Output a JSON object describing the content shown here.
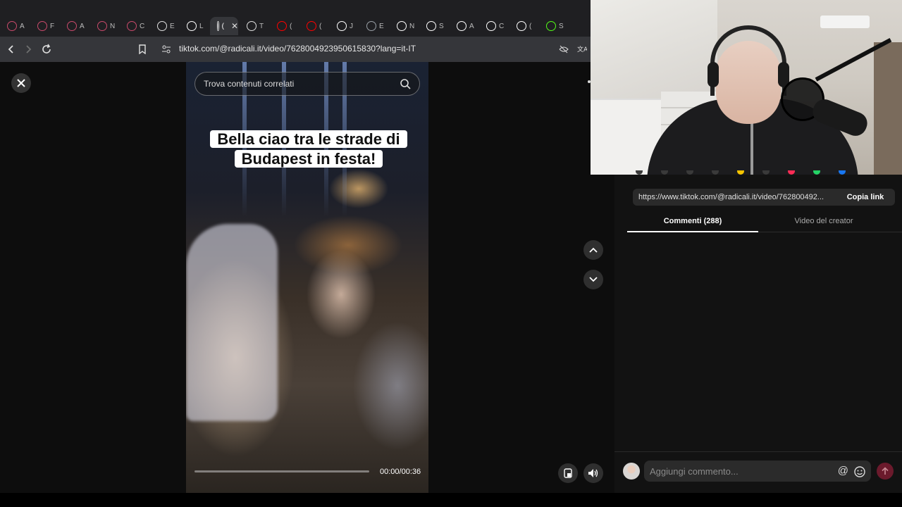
{
  "browser": {
    "tabs": [
      {
        "letter": "A",
        "icon": "record-icon",
        "color": "#c94a6b"
      },
      {
        "letter": "F",
        "icon": "record-icon",
        "color": "#c94a6b"
      },
      {
        "letter": "A",
        "icon": "record-icon",
        "color": "#c94a6b"
      },
      {
        "letter": "N",
        "icon": "record-icon",
        "color": "#c94a6b"
      },
      {
        "letter": "C",
        "icon": "puzzle-icon",
        "color": "#c94a6b"
      },
      {
        "letter": "E",
        "icon": "wordpress-icon",
        "color": "#e0e0e0"
      },
      {
        "letter": "L",
        "icon": "wikipedia-icon",
        "color": "#ffffff"
      },
      {
        "letter": "(",
        "icon": "tiktok-icon",
        "color": "#ffffff",
        "active": true
      },
      {
        "letter": "T",
        "icon": "play-icon",
        "color": "#e0e0e0"
      },
      {
        "letter": "(",
        "icon": "youtube-icon",
        "color": "#ff0000"
      },
      {
        "letter": "(",
        "icon": "youtube-icon",
        "color": "#ff0000"
      },
      {
        "letter": "J",
        "icon": "wikipedia-icon",
        "color": "#ffffff"
      },
      {
        "letter": "E",
        "icon": "globe-icon",
        "color": "#9aa0a6"
      },
      {
        "letter": "N",
        "icon": "openai-icon",
        "color": "#ffffff"
      },
      {
        "letter": "S",
        "icon": "openai-icon",
        "color": "#ffffff"
      },
      {
        "letter": "A",
        "icon": "openai-icon",
        "color": "#ffffff"
      },
      {
        "letter": "C",
        "icon": "wikipedia-icon",
        "color": "#ffffff"
      },
      {
        "letter": "(",
        "icon": "x-icon",
        "color": "#ffffff"
      },
      {
        "letter": "S",
        "icon": "kick-icon",
        "color": "#53fc18"
      }
    ],
    "url": "tiktok.com/@radicali.it/video/7628004923950615830?lang=it-IT"
  },
  "video": {
    "search_placeholder": "Trova contenuti correlati",
    "caption_line1": "Bella ciao tra le strade di",
    "caption_line2": "Budapest in festa!",
    "time": "00:00/00:36",
    "progress": 0
  },
  "panel": {
    "link_url": "https://www.tiktok.com/@radicali.it/video/762800492...",
    "copy_link_label": "Copia link",
    "tabs": [
      "Commenti (288)",
      "Video del creator"
    ],
    "comment_placeholder": "Aggiungi commento...",
    "mention_symbol": "@",
    "icon_dot_colors": [
      "#3a3a3a",
      "#3a3a3a",
      "#3a3a3a",
      "#3a3a3a",
      "#f5c400",
      "#3a3a3a",
      "#fe2c55",
      "#25d366",
      "#1877f2"
    ]
  }
}
